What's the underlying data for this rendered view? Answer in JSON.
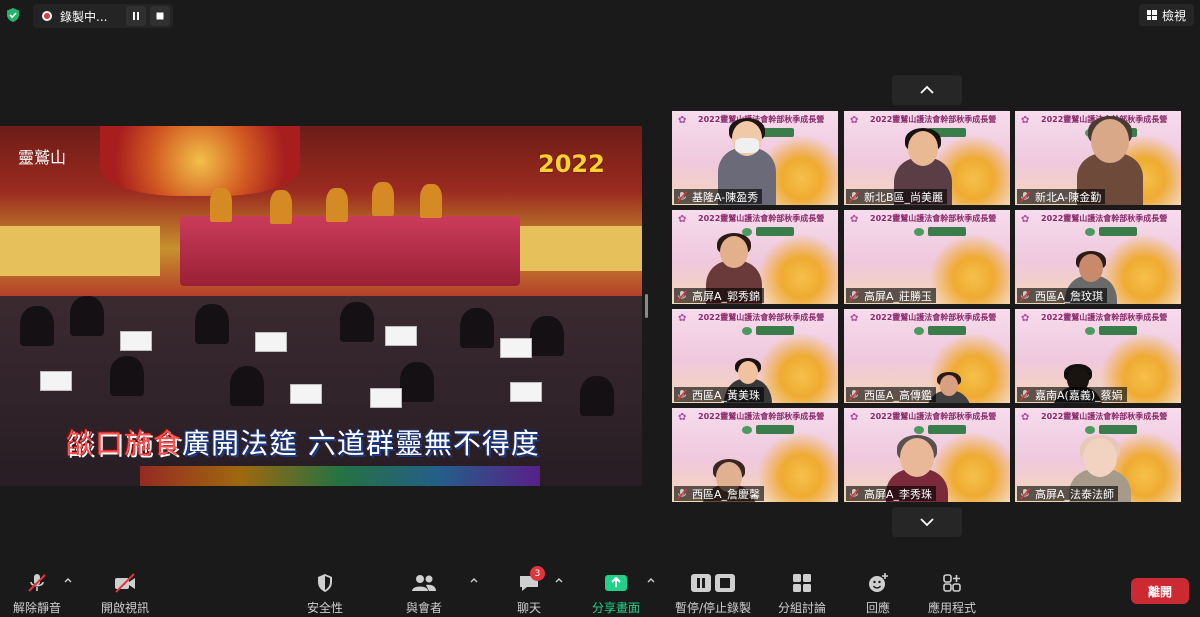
{
  "recording": {
    "label": "錄製中..."
  },
  "view": {
    "label": "檢視"
  },
  "main_video": {
    "year": "2022",
    "logo": "靈鷲山",
    "caption_part1": "燄口施食",
    "caption_part2": "廣開法筵  六道群靈無不得度"
  },
  "tile_banner": "2022靈鷲山護法會幹部秋季成長營",
  "participants": [
    {
      "name": "基隆A-陳盈秀",
      "muted": true
    },
    {
      "name": "新北B區_尚美麗",
      "muted": true
    },
    {
      "name": "新北A-陳金勤",
      "muted": true
    },
    {
      "name": "高屏A_郭秀錦",
      "muted": true
    },
    {
      "name": "高屏A_莊勝玉",
      "muted": true
    },
    {
      "name": "西區A_詹玟琪",
      "muted": true
    },
    {
      "name": "西區A_黃美珠",
      "muted": true
    },
    {
      "name": "西區A_高傳鑑",
      "muted": true
    },
    {
      "name": "嘉南A(嘉義)_蔡娟",
      "muted": true
    },
    {
      "name": "西區A_詹慶馨",
      "muted": true
    },
    {
      "name": "高屏A_李秀珠",
      "muted": true
    },
    {
      "name": "高屏A_法泰法師",
      "muted": true
    }
  ],
  "toolbar": {
    "unmute": "解除靜音",
    "start_video": "開啟視訊",
    "security": "安全性",
    "participants": "與會者",
    "chat": "聊天",
    "chat_badge": "3",
    "share": "分享畫面",
    "pause_recording": "暫停/停止錄製",
    "breakout": "分組討論",
    "reactions": "回應",
    "apps": "應用程式",
    "leave": "離開"
  },
  "colors": {
    "leave": "#cc2a33",
    "share": "#23d18b",
    "record": "#e0353b"
  }
}
